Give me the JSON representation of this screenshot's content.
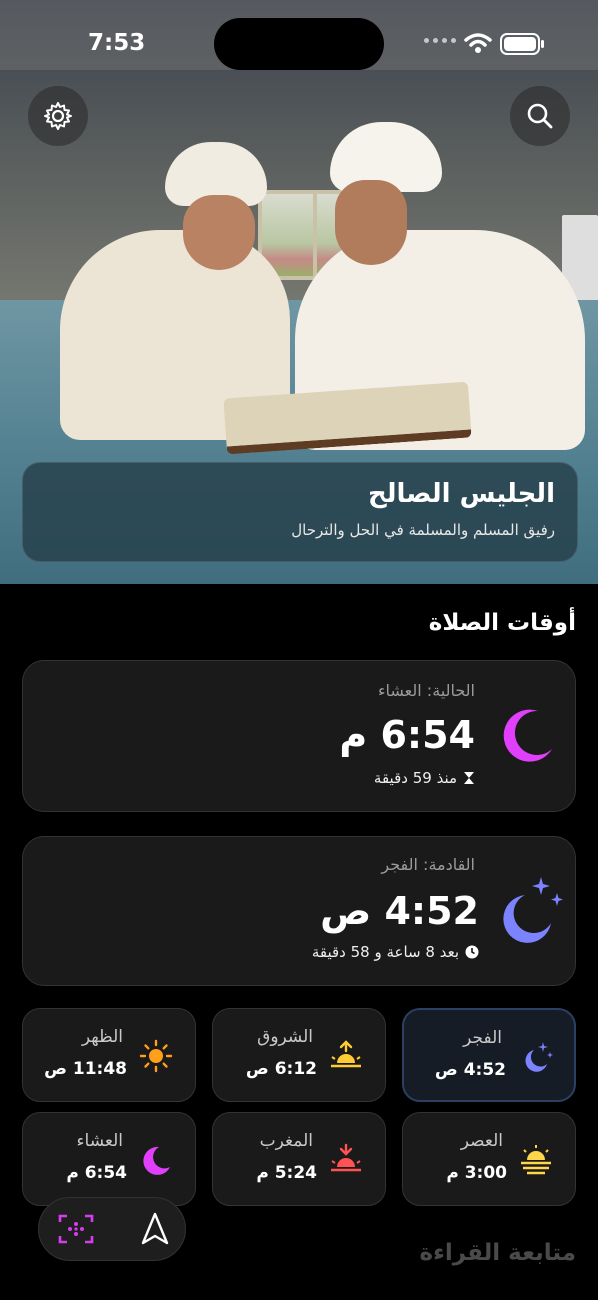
{
  "status": {
    "time": "7:53"
  },
  "hero": {
    "title": "الجليس الصالح",
    "subtitle": "رفيق المسلم والمسلمة في الحل والترحال"
  },
  "header": {
    "settings_icon": "gear-icon",
    "search_icon": "search-icon"
  },
  "prayer_section_title": "أوقات الصلاة",
  "current": {
    "label": "الحالية: العشاء",
    "time": "6:54 م",
    "elapsed": "منذ 59 دقيقة",
    "icon": "moon-icon",
    "icon_color": "#e040fb"
  },
  "next": {
    "label": "القادمة: الفجر",
    "time": "4:52 ص",
    "remaining": "بعد 8 ساعة و 58 دقيقة",
    "icon": "moon-stars-icon",
    "icon_color": "#7c83ff"
  },
  "prayers": [
    {
      "name": "الفجر",
      "time": "4:52 ص",
      "icon": "moon-stars-icon",
      "color": "#7c83ff",
      "active": true
    },
    {
      "name": "الشروق",
      "time": "6:12 ص",
      "icon": "sunrise-icon",
      "color": "#ffcc33"
    },
    {
      "name": "الظهر",
      "time": "11:48 ص",
      "icon": "sun-icon",
      "color": "#ff9f1c"
    },
    {
      "name": "العصر",
      "time": "3:00 م",
      "icon": "sun-horizon-icon",
      "color": "#ffd54a"
    },
    {
      "name": "المغرب",
      "time": "5:24 م",
      "icon": "sunset-icon",
      "color": "#ff5252"
    },
    {
      "name": "العشاء",
      "time": "6:54 م",
      "icon": "moon-icon",
      "color": "#e040fb"
    }
  ],
  "tabbar": {
    "qibla_icon": "navigation-arrow-icon",
    "tasbih_icon": "tasbih-counter-icon"
  },
  "reading_title": "متابعة القراءة"
}
